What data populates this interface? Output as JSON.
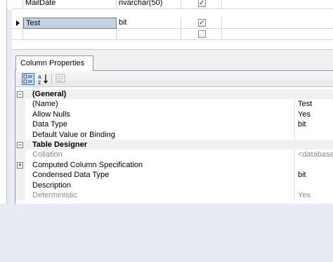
{
  "grid": {
    "rows": [
      {
        "name": "MailDate",
        "type": "nvarchar(50)",
        "allow_nulls": true
      },
      {
        "name": "Test",
        "type": "bit",
        "allow_nulls": true
      },
      {
        "name": "",
        "type": "",
        "allow_nulls": false
      }
    ]
  },
  "props": {
    "tab_label": "Column Properties",
    "toolbar": {
      "categorized_icon": "categorized-icon",
      "alphabetical_icon": "sort-az-icon",
      "property_pages_icon": "property-pages-icon"
    },
    "sections": [
      {
        "title": "(General)",
        "toggle": "⊟",
        "rows": [
          {
            "name": "(Name)",
            "value": "Test"
          },
          {
            "name": "Allow Nulls",
            "value": "Yes"
          },
          {
            "name": "Data Type",
            "value": "bit"
          },
          {
            "name": "Default Value or Binding",
            "value": ""
          }
        ]
      },
      {
        "title": "Table Designer",
        "toggle": "⊟",
        "rows": [
          {
            "name": "Collation",
            "value": "<database de",
            "muted": true
          },
          {
            "name": "Computed Column Specification",
            "value": "",
            "toggle": "⊞"
          },
          {
            "name": "Condensed Data Type",
            "value": "bit"
          },
          {
            "name": "Description",
            "value": ""
          },
          {
            "name": "Deterministic",
            "value": "Yes",
            "muted": true
          }
        ]
      }
    ]
  }
}
